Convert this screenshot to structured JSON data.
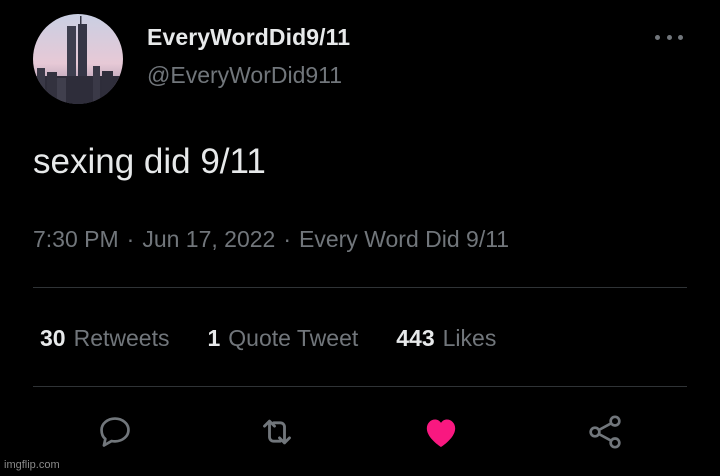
{
  "author": {
    "display_name": "EveryWordDid9/11",
    "handle": "@EveryWorDid911"
  },
  "tweet": {
    "text": "sexing did 9/11",
    "time": "7:30 PM",
    "date": "Jun 17, 2022",
    "source": "Every Word Did 9/11"
  },
  "stats": [
    {
      "count": "30",
      "label": "Retweets"
    },
    {
      "count": "1",
      "label": "Quote Tweet"
    },
    {
      "count": "443",
      "label": "Likes"
    }
  ],
  "actions": {
    "reply_icon": "reply-icon",
    "retweet_icon": "retweet-icon",
    "like_icon": "heart-icon",
    "share_icon": "share-icon"
  },
  "colors": {
    "background": "#000000",
    "primary_text": "#e7e9ea",
    "secondary_text": "#71767b",
    "like_active": "#f91880",
    "divider": "#2f3336"
  },
  "watermark": "imgflip.com"
}
